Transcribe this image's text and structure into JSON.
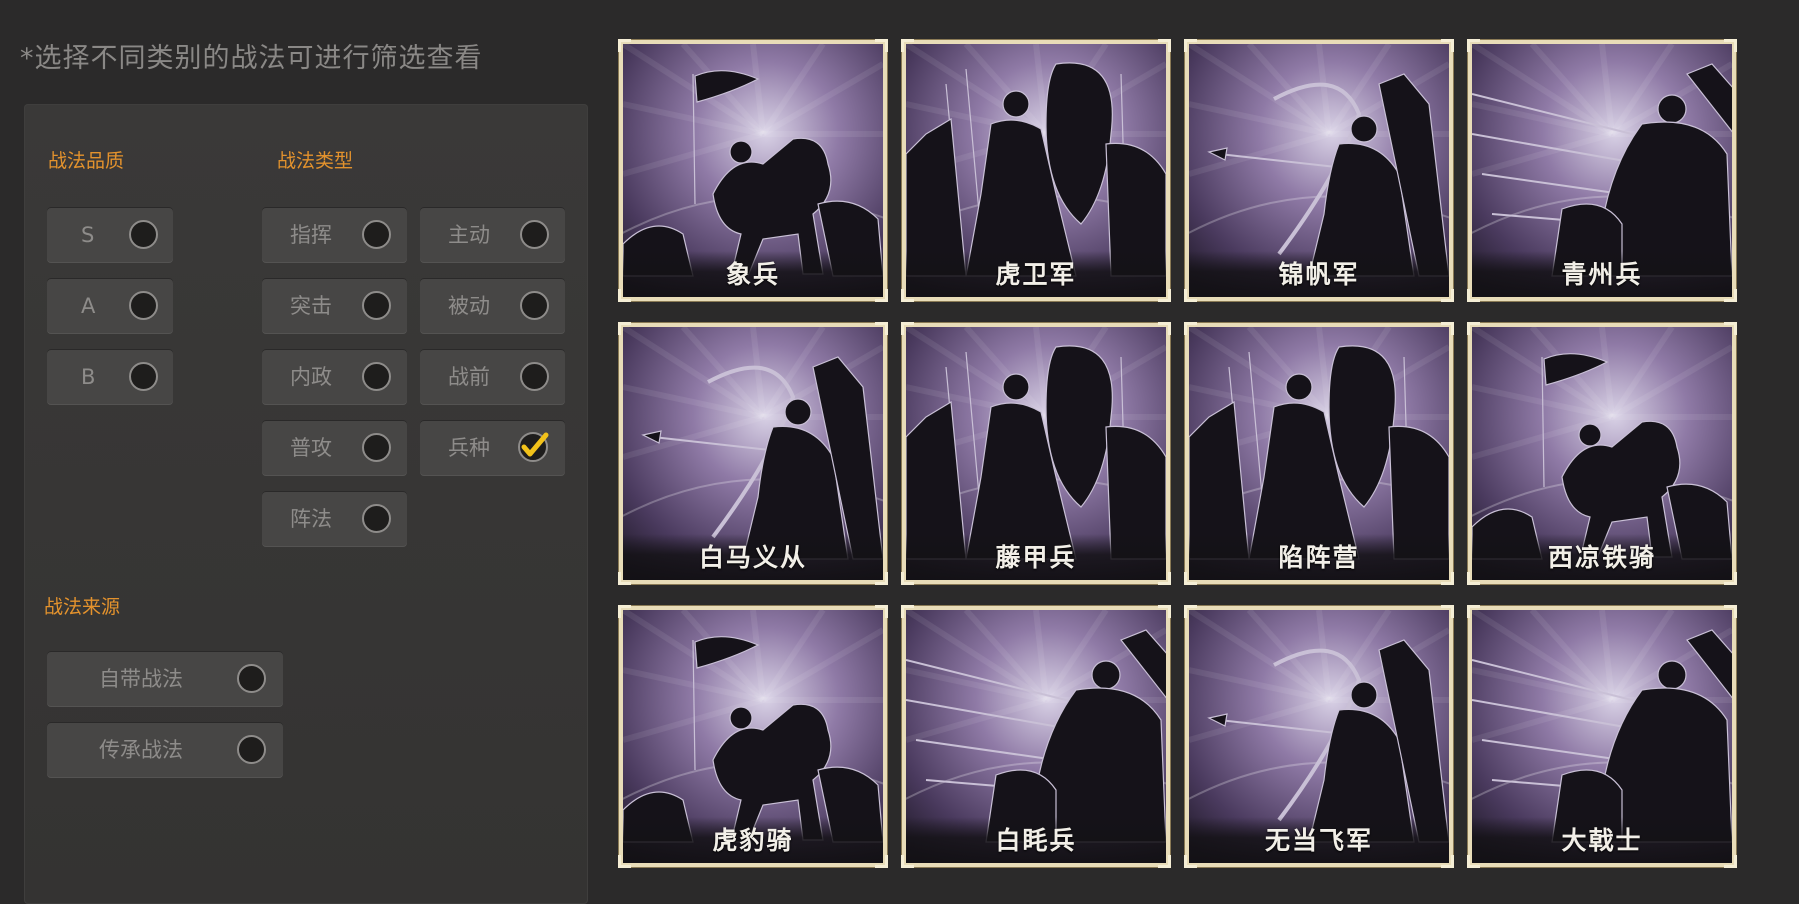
{
  "hint": "*选择不同类别的战法可进行筛选查看",
  "filters": {
    "quality": {
      "title": "战法品质",
      "options": [
        {
          "label": "S",
          "checked": false
        },
        {
          "label": "A",
          "checked": false
        },
        {
          "label": "B",
          "checked": false
        }
      ]
    },
    "type": {
      "title": "战法类型",
      "options": [
        {
          "label": "指挥",
          "checked": false
        },
        {
          "label": "主动",
          "checked": false
        },
        {
          "label": "突击",
          "checked": false
        },
        {
          "label": "被动",
          "checked": false
        },
        {
          "label": "内政",
          "checked": false
        },
        {
          "label": "战前",
          "checked": false
        },
        {
          "label": "普攻",
          "checked": false
        },
        {
          "label": "兵种",
          "checked": true
        },
        {
          "label": "阵法",
          "checked": false
        }
      ]
    },
    "source": {
      "title": "战法来源",
      "options": [
        {
          "label": "自带战法",
          "checked": false
        },
        {
          "label": "传承战法",
          "checked": false
        }
      ]
    }
  },
  "cards": [
    {
      "name": "象兵",
      "art": "flag-rider-icon"
    },
    {
      "name": "虎卫军",
      "art": "shield-soldier-icon"
    },
    {
      "name": "锦帆军",
      "art": "archer-icon"
    },
    {
      "name": "青州兵",
      "art": "spear-charge-icon"
    },
    {
      "name": "白马义从",
      "art": "archer-icon"
    },
    {
      "name": "藤甲兵",
      "art": "shield-soldier-icon"
    },
    {
      "name": "陷阵营",
      "art": "shield-soldier-icon"
    },
    {
      "name": "西凉铁骑",
      "art": "flag-rider-icon"
    },
    {
      "name": "虎豹骑",
      "art": "flag-rider-icon"
    },
    {
      "name": "白眊兵",
      "art": "spear-charge-icon"
    },
    {
      "name": "无当飞军",
      "art": "archer-icon"
    },
    {
      "name": "大戟士",
      "art": "spear-charge-icon"
    }
  ],
  "colors": {
    "accent": "#e3922d",
    "check": "#f2c21a",
    "card_frame": "#e8dcb8"
  }
}
